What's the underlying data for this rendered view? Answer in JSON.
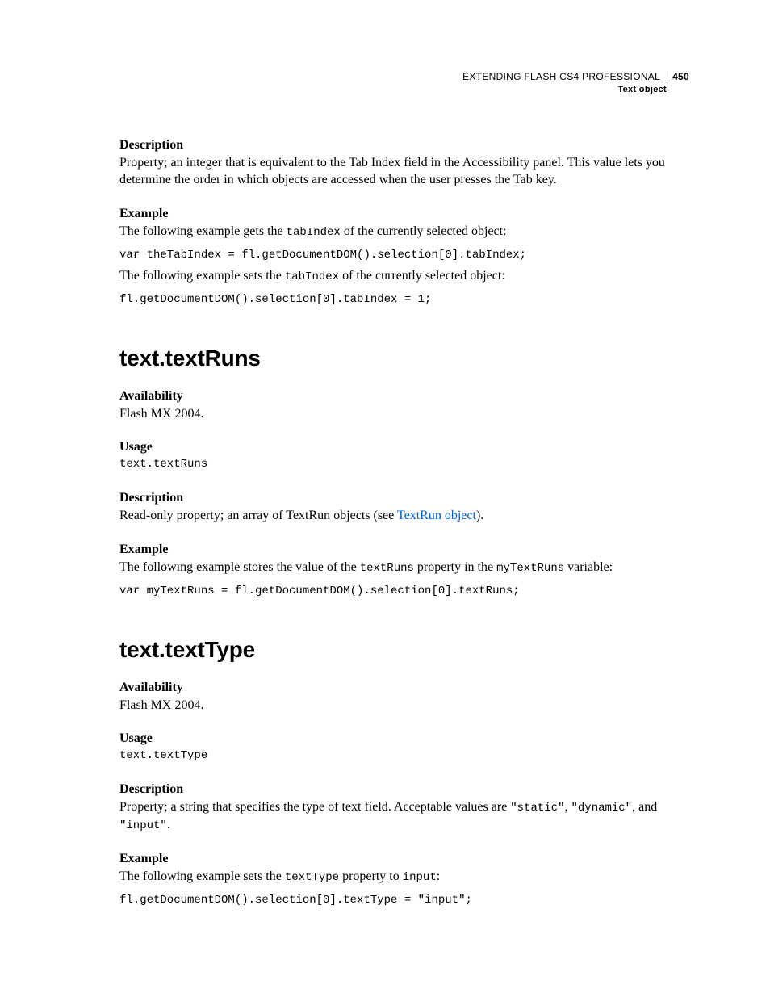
{
  "header": {
    "running_title": "EXTENDING FLASH CS4 PROFESSIONAL",
    "page_number": "450",
    "section_name": "Text object"
  },
  "sec0": {
    "desc_label": "Description",
    "desc_text": "Property; an integer that is equivalent to the Tab Index field in the Accessibility panel. This value lets you determine the order in which objects are accessed when the user presses the Tab key.",
    "example_label": "Example",
    "example_intro_1a": "The following example gets the ",
    "example_intro_1_code": "tabIndex",
    "example_intro_1b": " of the currently selected object:",
    "code1": "var theTabIndex = fl.getDocumentDOM().selection[0].tabIndex;",
    "example_intro_2a": "The following example sets the ",
    "example_intro_2_code": "tabIndex",
    "example_intro_2b": " of the currently selected object:",
    "code2": "fl.getDocumentDOM().selection[0].tabIndex = 1;"
  },
  "sec1": {
    "heading": "text.textRuns",
    "availability_label": "Availability",
    "availability_text": "Flash MX 2004.",
    "usage_label": "Usage",
    "usage_code": "text.textRuns",
    "desc_label": "Description",
    "desc_text_a": "Read-only property; an array of TextRun objects (see ",
    "desc_link": "TextRun object",
    "desc_text_b": ").",
    "example_label": "Example",
    "example_intro_a": "The following example stores the value of the ",
    "example_code1": "textRuns",
    "example_intro_b": " property in the ",
    "example_code2": "myTextRuns",
    "example_intro_c": " variable:",
    "code": "var myTextRuns = fl.getDocumentDOM().selection[0].textRuns;"
  },
  "sec2": {
    "heading": "text.textType",
    "availability_label": "Availability",
    "availability_text": "Flash MX 2004.",
    "usage_label": "Usage",
    "usage_code": "text.textType",
    "desc_label": "Description",
    "desc_text_a": "Property; a string that specifies the type of text field. Acceptable values are ",
    "desc_code1": "\"static\"",
    "desc_text_b": ", ",
    "desc_code2": "\"dynamic\"",
    "desc_text_c": ", and ",
    "desc_code3": "\"input\"",
    "desc_text_d": ".",
    "example_label": "Example",
    "example_intro_a": "The following example sets the ",
    "example_code1": "textType",
    "example_intro_b": " property to ",
    "example_code2": "input",
    "example_intro_c": ":",
    "code": "fl.getDocumentDOM().selection[0].textType = \"input\";"
  }
}
